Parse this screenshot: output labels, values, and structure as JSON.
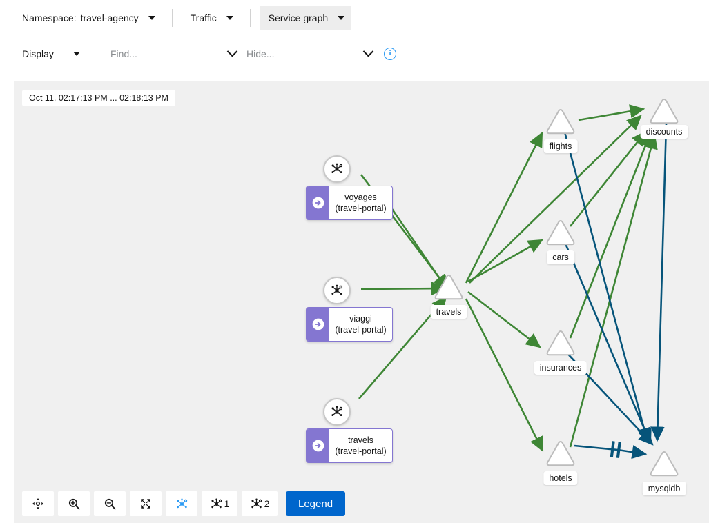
{
  "toolbar": {
    "namespace_label": "Namespace:",
    "namespace_value": "travel-agency",
    "traffic_label": "Traffic",
    "graph_type_value": "Service graph",
    "display_label": "Display",
    "find_placeholder": "Find...",
    "find_value": "",
    "hide_placeholder": "Hide...",
    "hide_value": "",
    "info_icon": "info-circle-icon",
    "caret_icon": "caret-down-icon",
    "chevron_icon": "chevron-down-icon"
  },
  "graph": {
    "time_range_badge": "Oct 11, 02:17:13 PM ... 02:18:13 PM",
    "edge_colors": {
      "http_healthy": "#3e8635",
      "tcp": "#06547a"
    },
    "node_colors": {
      "box_accent": "#8476d1",
      "triangle_fill": "#ffffff",
      "triangle_stroke": "#bcbcbc"
    },
    "box_nodes": [
      {
        "name": "voyages",
        "namespace": "(travel-portal)",
        "badge_icon": "arrow-circle-right-icon",
        "service_icon": "service-node-icon"
      },
      {
        "name": "viaggi",
        "namespace": "(travel-portal)",
        "badge_icon": "arrow-circle-right-icon",
        "service_icon": "service-node-icon"
      },
      {
        "name": "travels",
        "namespace": "(travel-portal)",
        "badge_icon": "arrow-circle-right-icon",
        "service_icon": "service-node-icon"
      }
    ],
    "service_nodes": [
      {
        "name": "travels"
      },
      {
        "name": "flights"
      },
      {
        "name": "discounts"
      },
      {
        "name": "cars"
      },
      {
        "name": "insurances"
      },
      {
        "name": "hotels"
      },
      {
        "name": "mysqldb"
      }
    ]
  },
  "graph_toolbar": {
    "buttons": [
      {
        "name": "drag-pan-button",
        "icon": "arrows-alt-icon",
        "label": ""
      },
      {
        "name": "zoom-in-button",
        "icon": "search-plus-icon",
        "label": ""
      },
      {
        "name": "zoom-out-button",
        "icon": "search-minus-icon",
        "label": ""
      },
      {
        "name": "fit-to-screen-button",
        "icon": "expand-arrows-icon",
        "label": ""
      },
      {
        "name": "layout-default-button",
        "icon": "topology-icon",
        "label": "",
        "active": true
      },
      {
        "name": "layout-1-button",
        "icon": "topology-icon",
        "label": "1"
      },
      {
        "name": "layout-2-button",
        "icon": "topology-icon",
        "label": "2"
      }
    ],
    "legend_label": "Legend"
  }
}
